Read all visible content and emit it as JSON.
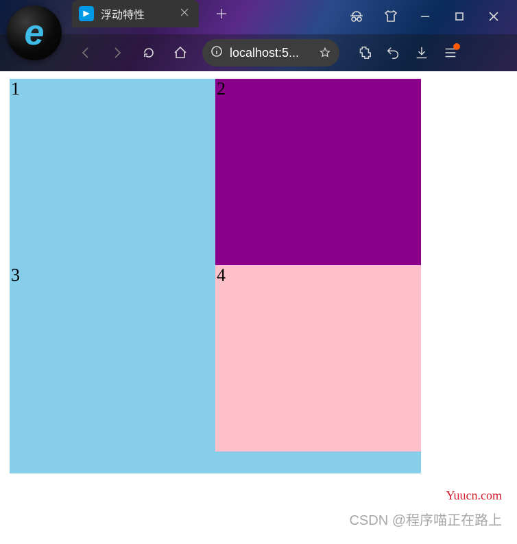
{
  "browser": {
    "app_logo_letter": "e",
    "tab": {
      "title": "浮动特性"
    },
    "address": {
      "display": "localhost:5...",
      "host": "localhost:5"
    },
    "icons": {
      "tab_close": "close-icon",
      "new_tab": "plus-icon",
      "incognito": "incognito-icon",
      "tshirt": "tshirt-icon",
      "minimize": "minimize-icon",
      "maximize": "maximize-icon",
      "window_close": "close-icon",
      "back": "chevron-left-icon",
      "forward": "chevron-right-icon",
      "reload": "reload-icon",
      "home": "home-icon",
      "site_info": "info-icon",
      "favorite": "star-icon",
      "extensions": "puzzle-icon",
      "undo": "undo-icon",
      "download": "download-icon",
      "menu": "hamburger-icon"
    }
  },
  "page": {
    "boxes": [
      {
        "label": "1",
        "color": "#87ceeb"
      },
      {
        "label": "2",
        "color": "#8b008b"
      },
      {
        "label": "3",
        "color": "#87ceeb"
      },
      {
        "label": "4",
        "color": "#ffc0cb"
      }
    ]
  },
  "watermarks": {
    "site": "Yuucn.com",
    "csdn": "CSDN @程序喵正在路上"
  }
}
